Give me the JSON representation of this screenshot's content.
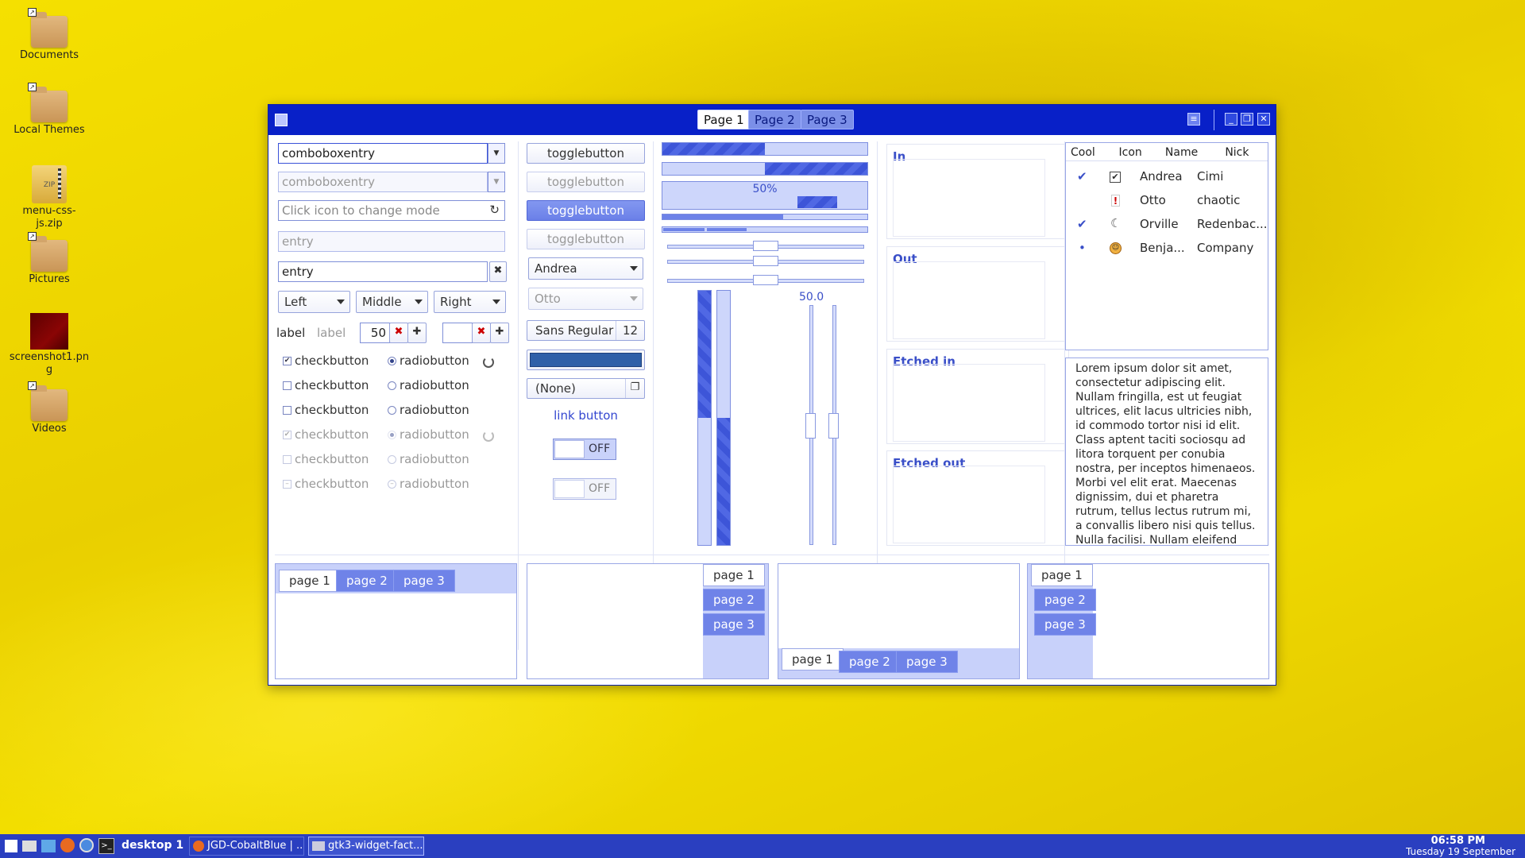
{
  "desktop": {
    "icons": [
      {
        "label": "Documents",
        "type": "folder"
      },
      {
        "label": "Local Themes",
        "type": "folder"
      },
      {
        "label": "menu-css-js.zip",
        "type": "zip",
        "badge": "ZIP"
      },
      {
        "label": "Pictures",
        "type": "folder"
      },
      {
        "label": "screenshot1.png",
        "type": "image"
      },
      {
        "label": "Videos",
        "type": "folder"
      }
    ]
  },
  "window": {
    "tabs": [
      "Page 1",
      "Page 2",
      "Page 3"
    ],
    "col1": {
      "combo1": "comboboxentry",
      "combo2": "comboboxentry",
      "mode_placeholder": "Click icon to change mode",
      "entry_disabled": "entry",
      "entry": "entry",
      "align": [
        "Left",
        "Middle",
        "Right"
      ],
      "label1": "label",
      "label2": "label",
      "spin_value": "50",
      "checks": [
        "checkbutton",
        "checkbutton",
        "checkbutton",
        "checkbutton",
        "checkbutton",
        "checkbutton"
      ],
      "radios": [
        "radiobutton",
        "radiobutton",
        "radiobutton",
        "radiobutton",
        "radiobutton",
        "radiobutton"
      ]
    },
    "col2": {
      "toggles": [
        "togglebutton",
        "togglebutton",
        "togglebutton",
        "togglebutton"
      ],
      "combo_andrea": "Andrea",
      "combo_otto": "Otto",
      "font_name": "Sans Regular",
      "font_size": "12",
      "color": "#2f60a8",
      "file": "(None)",
      "link": "link button",
      "switch1": "OFF",
      "switch2": "OFF"
    },
    "col3": {
      "progress_label": "50%",
      "scale_value": "50.0",
      "progress_fraction": 0.5
    },
    "frames": [
      "In",
      "Out",
      "Etched in",
      "Etched out"
    ],
    "tree": {
      "headers": [
        "Cool",
        "Icon",
        "Name",
        "Nick"
      ],
      "rows": [
        {
          "cool": "✔",
          "icon": "check-icon",
          "name": "Andrea",
          "nick": "Cimi"
        },
        {
          "cool": "",
          "icon": "warning-icon",
          "name": "Otto",
          "nick": "chaotic"
        },
        {
          "cool": "✔",
          "icon": "moon-icon",
          "name": "Orville",
          "nick": "Redenbac..."
        },
        {
          "cool": "•",
          "icon": "face-icon",
          "name": "Benja...",
          "nick": "Company"
        }
      ]
    },
    "textview": "Lorem ipsum dolor sit amet, consectetur adipiscing elit. Nullam fringilla, est ut feugiat ultrices, elit lacus ultricies nibh, id commodo tortor nisi id elit. Class aptent taciti sociosqu ad litora torquent per conubia nostra, per inceptos himenaeos. Morbi vel elit erat. Maecenas dignissim, dui et pharetra rutrum, tellus lectus rutrum mi, a convallis libero nisi quis tellus. Nulla facilisi. Nullam eleifend",
    "notebook_tabs": [
      "page 1",
      "page 2",
      "page 3"
    ]
  },
  "taskbar": {
    "desktop": "desktop 1",
    "tasks": [
      "JGD-CobaltBlue | ...",
      "gtk3-widget-fact..."
    ],
    "time": "06:58 PM",
    "date": "Tuesday 19 September"
  }
}
